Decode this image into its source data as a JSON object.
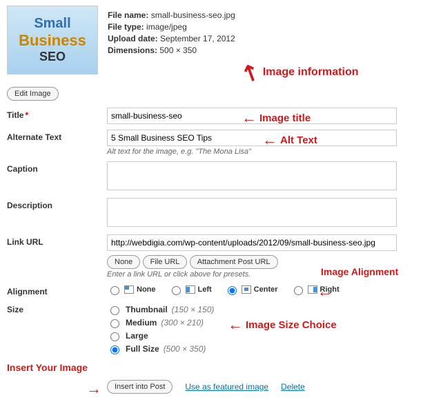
{
  "thumb": {
    "l1": "Small",
    "l2": "Business",
    "l3": "SEO"
  },
  "meta": {
    "fileNameLabel": "File name:",
    "fileName": "small-business-seo.jpg",
    "fileTypeLabel": "File type:",
    "fileType": "image/jpeg",
    "uploadDateLabel": "Upload date:",
    "uploadDate": "September 17, 2012",
    "dimLabel": "Dimensions:",
    "dim": "500 × 350"
  },
  "editImage": "Edit Image",
  "labels": {
    "title": "Title",
    "alt": "Alternate Text",
    "caption": "Caption",
    "desc": "Description",
    "linkUrl": "Link URL",
    "alignment": "Alignment",
    "size": "Size"
  },
  "values": {
    "title": "small-business-seo",
    "alt": "5 Small Business SEO Tips",
    "linkUrl": "http://webdigia.com/wp-content/uploads/2012/09/small-business-seo.jpg"
  },
  "help": {
    "alt": "Alt text for the image, e.g. \"The Mona Lisa\"",
    "linkUrl": "Enter a link URL or click above for presets."
  },
  "linkButtons": {
    "none": "None",
    "file": "File URL",
    "post": "Attachment Post URL"
  },
  "align": {
    "none": "None",
    "left": "Left",
    "center": "Center",
    "right": "Right"
  },
  "sizes": {
    "thumb": {
      "label": "Thumbnail",
      "dim": "(150 × 150)"
    },
    "med": {
      "label": "Medium",
      "dim": "(300 × 210)"
    },
    "large": {
      "label": "Large",
      "dim": ""
    },
    "full": {
      "label": "Full Size",
      "dim": "(500 × 350)"
    }
  },
  "actions": {
    "insert": "Insert into Post",
    "featured": "Use as featured image",
    "delete": "Delete"
  },
  "annotations": {
    "imageInfo": "Image information",
    "imageTitle": "Image title",
    "altText": "Alt Text",
    "imageAlignment": "Image Alignment",
    "imageSize": "Image Size Choice",
    "insertYour": "Insert Your Image"
  },
  "arrows": {
    "left": "←",
    "right": "→"
  }
}
